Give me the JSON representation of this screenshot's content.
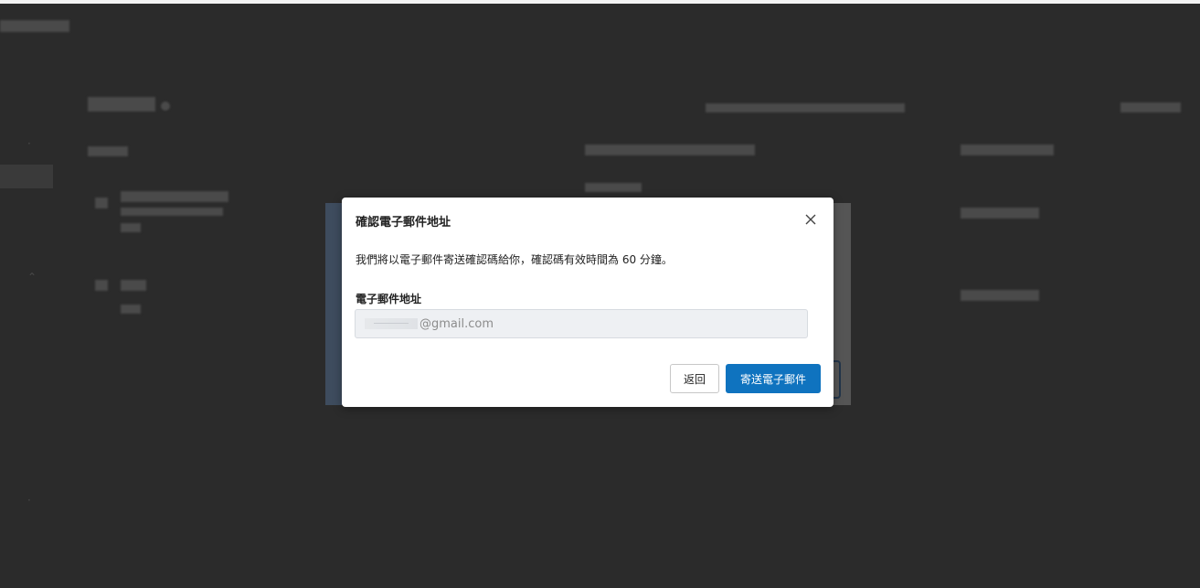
{
  "modal": {
    "title": "確認電子郵件地址",
    "close_icon": "close-icon",
    "description": "我們將以電子郵件寄送確認碼給你，確認碼有效時間為 60 分鐘。",
    "email_label": "電子郵件地址",
    "email_value_visible": "@gmail.com",
    "back_label": "返回",
    "send_label": "寄送電子郵件",
    "accent_color": "#0f73bf"
  }
}
